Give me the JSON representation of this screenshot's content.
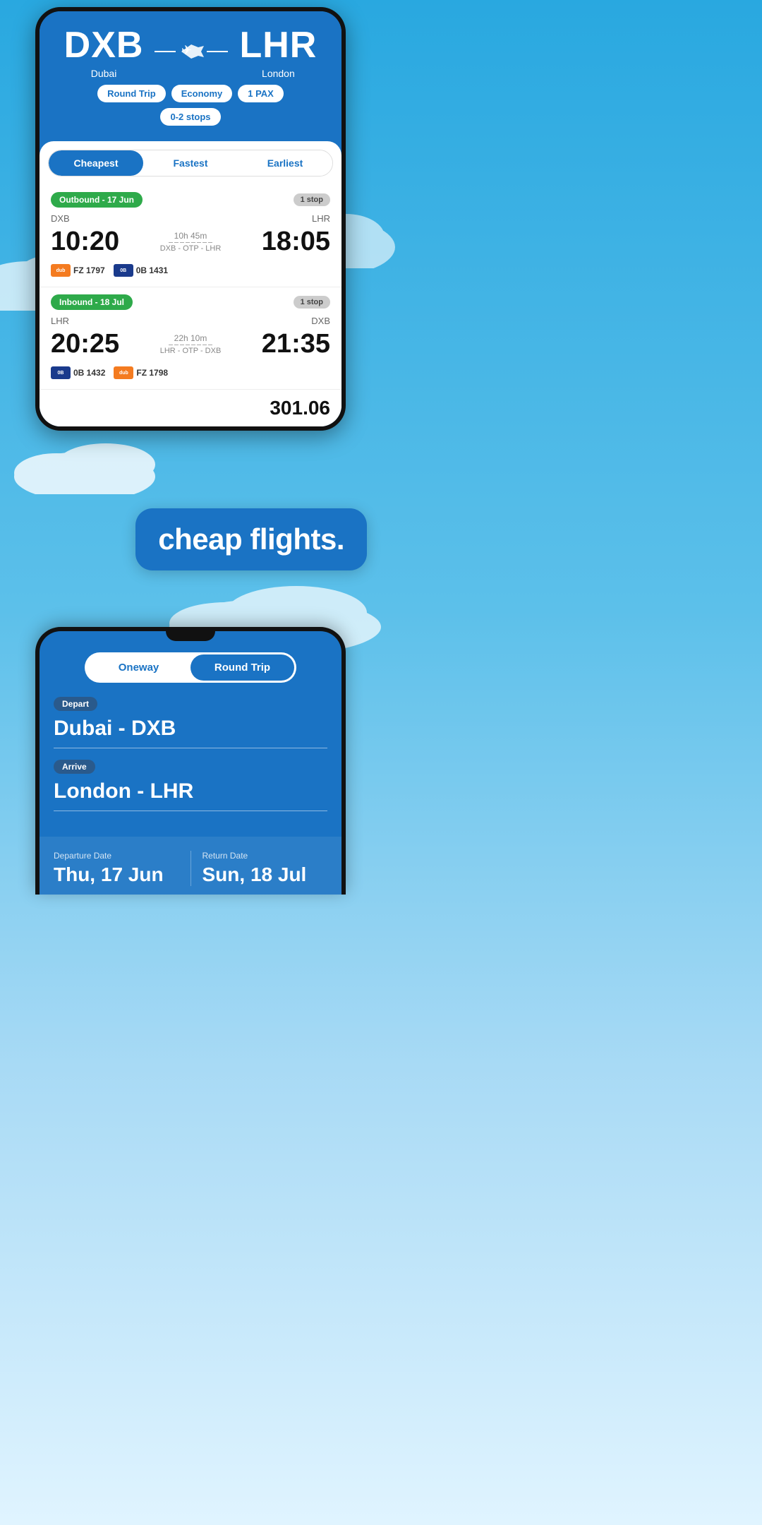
{
  "background": {
    "color": "#3aabdf"
  },
  "phone_top": {
    "from_code": "DXB",
    "from_name": "Dubai",
    "to_code": "LHR",
    "to_name": "London",
    "filters": {
      "trip_type": "Round Trip",
      "cabin": "Economy",
      "pax": "1 PAX",
      "stops": "0-2 stops"
    },
    "sort_tabs": [
      "Cheapest",
      "Fastest",
      "Earliest"
    ],
    "active_tab": "Cheapest",
    "outbound": {
      "label": "Outbound - 17 Jun",
      "stops_badge": "1 stop",
      "from": "DXB",
      "to": "LHR",
      "dep_time": "10:20",
      "arr_time": "18:05",
      "duration": "10h 45m",
      "route": "DXB - OTP - LHR",
      "airlines": [
        {
          "logo_text": "dubai",
          "logo_color": "orange",
          "flight": "FZ 1797"
        },
        {
          "logo_text": "0B",
          "logo_color": "blue",
          "flight": "0B 1431"
        }
      ]
    },
    "inbound": {
      "label": "Inbound - 18 Jul",
      "stops_badge": "1 stop",
      "from": "LHR",
      "to": "DXB",
      "dep_time": "20:25",
      "arr_time": "21:35",
      "duration": "22h 10m",
      "route": "LHR - OTP - DXB",
      "airlines": [
        {
          "logo_text": "0B",
          "logo_color": "blue",
          "flight": "0B 1432"
        },
        {
          "logo_text": "dubai",
          "logo_color": "orange",
          "flight": "FZ 1798"
        }
      ]
    }
  },
  "promo": {
    "text": "cheap flights."
  },
  "phone_bottom": {
    "trip_toggle": {
      "options": [
        "Oneway",
        "Round Trip"
      ],
      "active": "Round Trip"
    },
    "depart_label": "Depart",
    "depart_value": "Dubai - DXB",
    "arrive_label": "Arrive",
    "arrive_value": "London - LHR",
    "departure_date_label": "Departure Date",
    "departure_date": "Thu, 17 Jun",
    "return_date_label": "Return Date",
    "return_date": "Sun, 18 Jul"
  }
}
